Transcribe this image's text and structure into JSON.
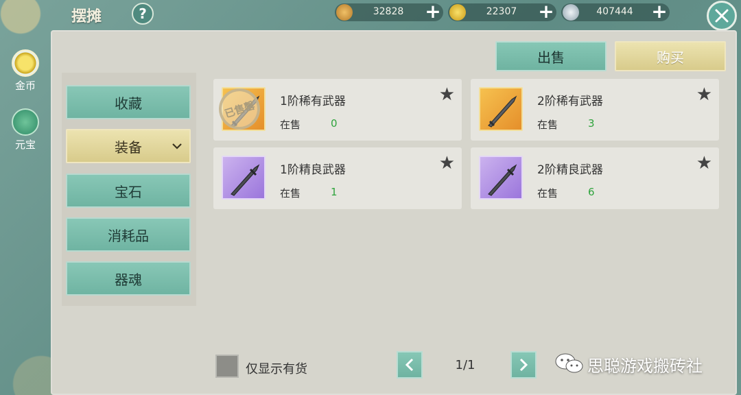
{
  "header": {
    "title": "摆摊",
    "help_label": "?"
  },
  "currencies": [
    {
      "icon": "copper-coin-icon",
      "value": "32828",
      "color": "#d8a24a"
    },
    {
      "icon": "gold-ingot-icon",
      "value": "22307",
      "color": "#e8c43a"
    },
    {
      "icon": "silver-ingot-icon",
      "value": "407444",
      "color": "#b9c7cf"
    }
  ],
  "side_tabs": [
    {
      "label": "金币",
      "icon": "gold-coin-icon",
      "active": true
    },
    {
      "label": "元宝",
      "icon": "yuanbao-icon",
      "active": false
    }
  ],
  "actions": {
    "sell_label": "出售",
    "buy_label": "购买"
  },
  "categories": [
    {
      "label": "收藏"
    },
    {
      "label": "装备",
      "active": true,
      "expand_icon": "chevron-down-icon"
    },
    {
      "label": "宝石"
    },
    {
      "label": "消耗品"
    },
    {
      "label": "器魂"
    }
  ],
  "items": [
    {
      "name": "1阶稀有武器",
      "status_label": "在售",
      "count": "0",
      "rarity": "rare",
      "sold_out": true,
      "sold_out_label": "已售罄",
      "icon": "sword-icon"
    },
    {
      "name": "2阶稀有武器",
      "status_label": "在售",
      "count": "3",
      "rarity": "rare",
      "sold_out": false,
      "icon": "sword-icon"
    },
    {
      "name": "1阶精良武器",
      "status_label": "在售",
      "count": "1",
      "rarity": "fine",
      "sold_out": false,
      "icon": "sword-icon"
    },
    {
      "name": "2阶精良武器",
      "status_label": "在售",
      "count": "6",
      "rarity": "fine",
      "sold_out": false,
      "icon": "sword-icon"
    }
  ],
  "footer": {
    "only_in_stock_label": "仅显示有货",
    "page_indicator": "1/1",
    "watermark_text": "思聪游戏搬砖社",
    "watermark_icon": "wechat-icon"
  },
  "colors": {
    "accent_green": "#6fb3a1",
    "accent_gold": "#d8cb8b",
    "count_green": "#2ea33c"
  }
}
